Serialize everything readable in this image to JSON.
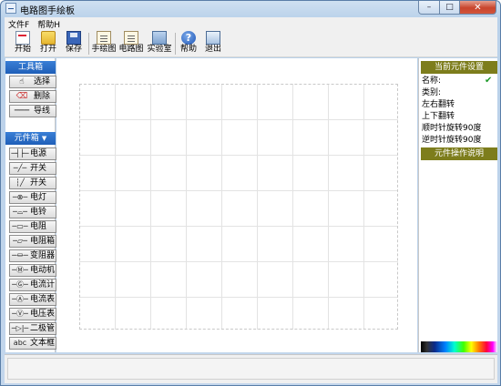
{
  "window": {
    "title": "电路图手绘板",
    "min": "–",
    "max": "□",
    "close": "✕"
  },
  "menu": [
    {
      "label": "文件F"
    },
    {
      "label": "帮助H"
    }
  ],
  "toolbar": [
    {
      "label": "开始",
      "icon": "new-doc-icon"
    },
    {
      "label": "打开",
      "icon": "open-folder-icon"
    },
    {
      "label": "保存",
      "icon": "save-disk-icon"
    },
    {
      "label": "手绘图",
      "icon": "hand-draw-icon"
    },
    {
      "label": "电路图",
      "icon": "circuit-doc-icon"
    },
    {
      "label": "实验室",
      "icon": "lab-icon"
    },
    {
      "label": "帮助",
      "icon": "help-icon"
    },
    {
      "label": "退出",
      "icon": "exit-icon"
    }
  ],
  "toolbox": {
    "title": "工具箱",
    "tools": [
      {
        "label": "选择",
        "symbol": "☝",
        "icon": "hand-pointer-icon"
      },
      {
        "label": "删除",
        "symbol": "⌫",
        "icon": "eraser-icon"
      },
      {
        "label": "导线",
        "symbol": "───",
        "icon": "wire-icon"
      }
    ]
  },
  "components": {
    "title": "元件箱",
    "arrow": "▼",
    "items": [
      {
        "symbol": "─┤├─",
        "label": "电源"
      },
      {
        "symbol": "─╱─",
        "label": "开关"
      },
      {
        "symbol": "┆╱",
        "label": "开关"
      },
      {
        "symbol": "─⊗─",
        "label": "电灯"
      },
      {
        "symbol": "─⌓─",
        "label": "电铃"
      },
      {
        "symbol": "─▭─",
        "label": "电阻"
      },
      {
        "symbol": "─▱─",
        "label": "电阻箱"
      },
      {
        "symbol": "─⏛─",
        "label": "变阻器"
      },
      {
        "symbol": "─Ⓜ─",
        "label": "电动机"
      },
      {
        "symbol": "─Ⓖ─",
        "label": "电流计"
      },
      {
        "symbol": "─Ⓐ─",
        "label": "电流表"
      },
      {
        "symbol": "─Ⓥ─",
        "label": "电压表"
      },
      {
        "symbol": "─▷|─",
        "label": "二极管"
      },
      {
        "symbol": "abc",
        "label": "文本框"
      }
    ]
  },
  "properties": {
    "title": "当前元件设置",
    "name_label": "名称:",
    "type_label": "类别:",
    "flip_h": "左右翻转",
    "flip_v": "上下翻转",
    "rotate_cw": "顺时针旋转90度",
    "rotate_ccw": "逆时针旋转90度",
    "help_title": "元件操作说明",
    "check": "✔"
  }
}
